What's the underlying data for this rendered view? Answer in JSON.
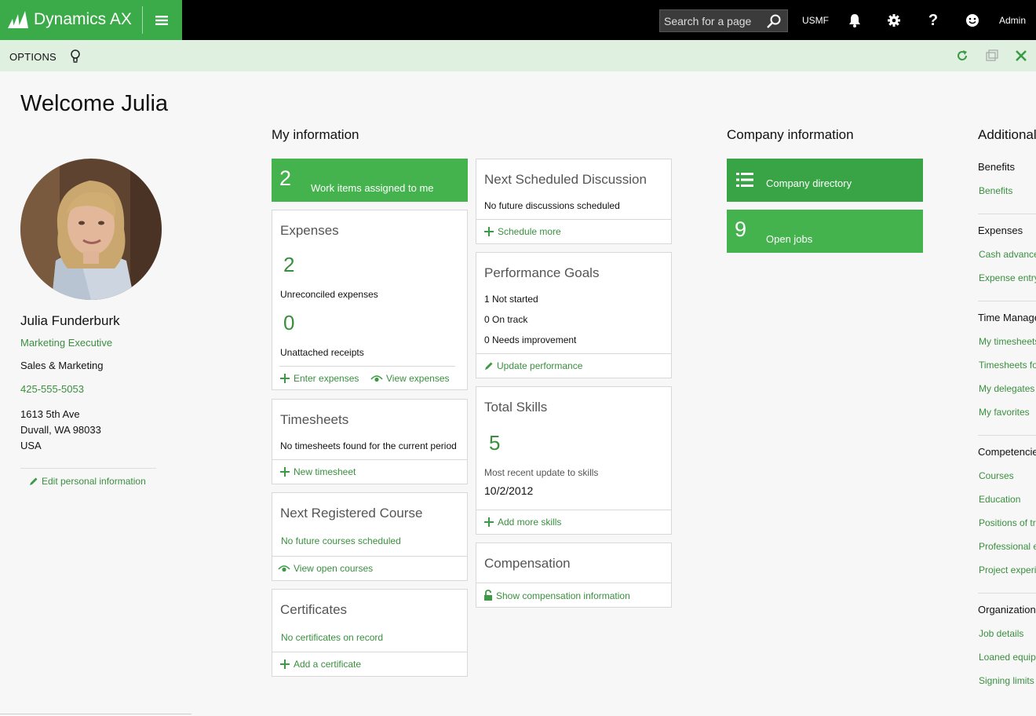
{
  "header": {
    "app_name": "Dynamics AX",
    "search_placeholder": "Search for a page",
    "company": "USMF",
    "user": "Admin",
    "brand_color": "#3bab4a"
  },
  "actionbar": {
    "options_label": "OPTIONS"
  },
  "welcome": "Welcome Julia",
  "profile": {
    "name": "Julia Funderburk",
    "title": "Marketing Executive",
    "department": "Sales & Marketing",
    "phone": "425-555-5053",
    "address_line1": "1613 5th Ave",
    "address_line2": "Duvall, WA 98033",
    "address_line3": "USA",
    "edit_link": "Edit personal information"
  },
  "my_information": {
    "heading": "My information",
    "work_items": {
      "count": "2",
      "label": "Work items assigned to me"
    },
    "expenses": {
      "title": "Expenses",
      "unreconciled_count": "2",
      "unreconciled_label": "Unreconciled expenses",
      "unattached_count": "0",
      "unattached_label": "Unattached receipts",
      "enter_link": "Enter expenses",
      "view_link": "View expenses"
    },
    "timesheets": {
      "title": "Timesheets",
      "text": "No timesheets found for the current period",
      "link": "New timesheet"
    },
    "course": {
      "title": "Next Registered Course",
      "text": "No future courses scheduled",
      "link": "View open courses"
    },
    "certificates": {
      "title": "Certificates",
      "text": "No certificates on record",
      "link": "Add a certificate"
    },
    "discussion": {
      "title": "Next Scheduled Discussion",
      "text": "No future discussions scheduled",
      "link": "Schedule more"
    },
    "performance": {
      "title": "Performance Goals",
      "line1": "1 Not started",
      "line2": "0 On track",
      "line3": "0 Needs improvement",
      "link": "Update performance"
    },
    "skills": {
      "title": "Total Skills",
      "count": "5",
      "label": "Most recent update to skills",
      "date": "10/2/2012",
      "link": "Add more skills"
    },
    "compensation": {
      "title": "Compensation",
      "link": "Show compensation information"
    }
  },
  "company_information": {
    "heading": "Company information",
    "directory_label": "Company directory",
    "open_jobs_count": "9",
    "open_jobs_label": "Open jobs"
  },
  "additional": {
    "heading": "Additional",
    "groups": [
      {
        "title": "Benefits",
        "links": [
          "Benefits"
        ]
      },
      {
        "title": "Expenses",
        "links": [
          "Cash advance",
          "Expense entry"
        ]
      },
      {
        "title": "Time Management",
        "links": [
          "My timesheets",
          "Timesheets for",
          "My delegates",
          "My favorites"
        ]
      },
      {
        "title": "Competencies",
        "links": [
          "Courses",
          "Education",
          "Positions of trust",
          "Professional experience",
          "Project experience"
        ]
      },
      {
        "title": "Organization",
        "links": [
          "Job details",
          "Loaned equipment",
          "Signing limits"
        ]
      }
    ]
  }
}
